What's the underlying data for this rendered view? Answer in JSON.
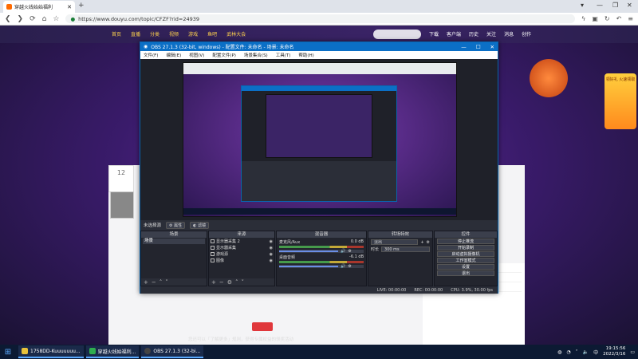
{
  "browser": {
    "tab_title": "穿越火线始始福利",
    "new_tab": "+",
    "url": "https://www.douyu.com/topic/CFZF?rid=24939",
    "secure_label": "https://",
    "window_controls": [
      "▾",
      "—",
      "❐",
      "✕"
    ]
  },
  "site": {
    "nav_items": [
      "首页",
      "直播",
      "分类",
      "视频",
      "游戏",
      "鱼吧",
      "武林大会"
    ],
    "header_icons": [
      "下载",
      "客户端",
      "历史",
      "关注",
      "消息",
      "创作"
    ],
    "room_number": "12",
    "footer_text": "您还可以「了解更多」规则，获得专属权益的领奖活动",
    "promo_text": "领好礼 火速领取",
    "chat_lines": [
      "H86EEN 开启神美荣盟麒麟",
      "UNIH 开启神美荣盟麒麟",
      "ATWSEN 开启神美荣盟麒麟"
    ]
  },
  "obs": {
    "title": "OBS 27.1.3 (32-bit, windows) - 配置文件: 未命名 - 场景: 未命名",
    "menu": [
      "文件(F)",
      "编辑(E)",
      "视图(V)",
      "配置文件(P)",
      "场景集合(S)",
      "工具(T)",
      "帮助(H)"
    ],
    "no_source_selected": "未选择源",
    "props_button": "属性",
    "filters_button": "滤镜",
    "docks": {
      "scenes": "场景",
      "sources": "来源",
      "mixer": "混音器",
      "transitions": "转场特效",
      "controls": "控件"
    },
    "scene_list": [
      "场景"
    ],
    "source_list": [
      "显示器采集 2",
      "显示器采集",
      "游戏源",
      "图像"
    ],
    "mixer_tracks": [
      {
        "name": "麦克风/Aux",
        "db": "0.0 dB"
      },
      {
        "name": "桌面音频",
        "db": "-6.1 dB"
      }
    ],
    "transition": {
      "type": "淡出",
      "duration_label": "时长",
      "duration": "300 ms"
    },
    "controls": [
      "停止推流",
      "开始录制",
      "启动虚拟摄像机",
      "工作室模式",
      "设置",
      "退出"
    ],
    "status": {
      "live": "LIVE: 00:00:00",
      "rec": "REC: 00:00:00",
      "cpu": "CPU: 3.9%, 30.00 fps"
    }
  },
  "taskbar": {
    "apps": [
      "1758DD-Kuuuuuuu...",
      "穿越火线始福利...",
      "OBS 27.1.3 (32-bi..."
    ],
    "time": "19:15:56",
    "date": "2022/3/16"
  },
  "colors": {
    "obs_title": "#0b6fc6",
    "obs_bg": "#2b2e38",
    "taskbar": "#0c1a33"
  }
}
